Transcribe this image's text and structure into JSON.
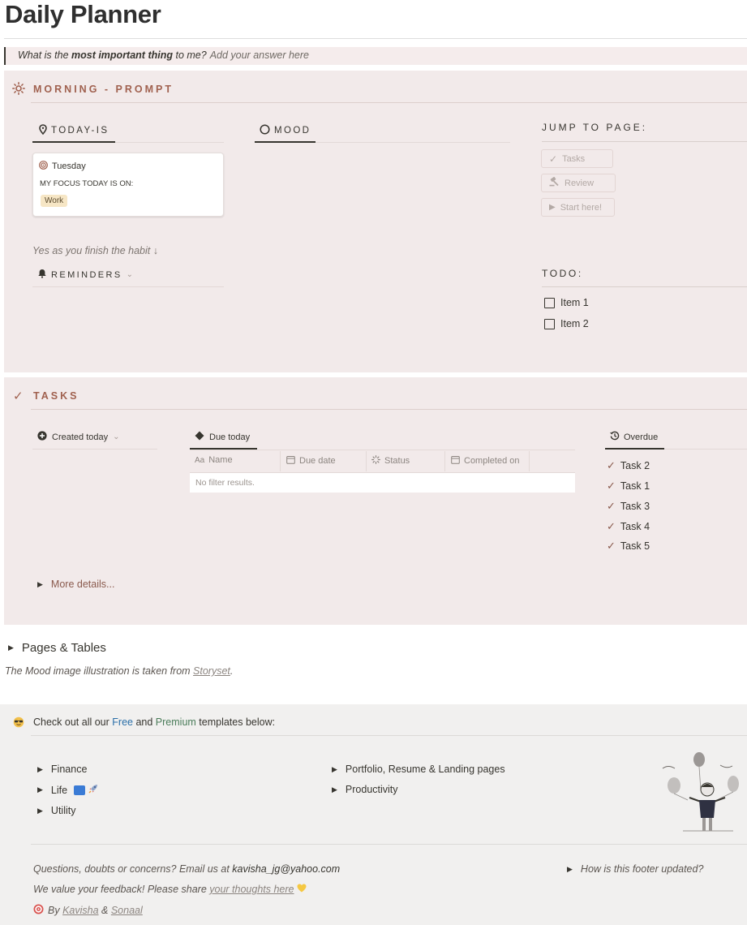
{
  "page": {
    "title": "Daily Planner"
  },
  "quote": {
    "prefix": "What is the ",
    "bold": "most important thing",
    "suffix": " to me?",
    "placeholder": "Add your answer here"
  },
  "morning": {
    "heading": "MORNING - PROMPT",
    "today_tab": "TODAY-IS",
    "mood_tab": "MOOD",
    "card": {
      "day": "Tuesday",
      "focus_label": "MY FOCUS TODAY IS ON:",
      "focus_tag": "Work"
    },
    "habit_hint": "Yes as you finish the habit ↓",
    "reminders_tab": "REMINDERS",
    "jump_heading": "JUMP TO PAGE:",
    "jump_buttons": [
      "Tasks",
      "Review",
      "Start here!"
    ],
    "todo_heading": "TODO:",
    "todo_items": [
      "Item 1",
      "Item 2"
    ]
  },
  "tasks": {
    "heading": "TASKS",
    "created_tab": "Created today",
    "due_tab": "Due today",
    "overdue_tab": "Overdue",
    "columns": [
      "Name",
      "Due date",
      "Status",
      "Completed on"
    ],
    "empty_text": "No filter results.",
    "overdue_items": [
      "Task 2",
      "Task 1",
      "Task 3",
      "Task 4",
      "Task 5"
    ],
    "more_details": "More details..."
  },
  "pages_tables": {
    "label": "Pages & Tables",
    "credit_prefix": "The Mood image illustration is taken from ",
    "credit_link": "Storyset",
    "credit_suffix": "."
  },
  "footer": {
    "intro_prefix": "Check out all our ",
    "free": "Free",
    "and": " and ",
    "premium": "Premium",
    "intro_suffix": " templates below:",
    "left_links": [
      "Finance",
      "Life",
      "Utility"
    ],
    "right_links": [
      "Portfolio, Resume & Landing pages",
      "Productivity"
    ],
    "questions_prefix": "Questions, doubts or concerns? Email us at ",
    "email": "kavisha_jg@yahoo.com",
    "feedback_prefix": "We value your feedback! Please share ",
    "feedback_link": "your thoughts here",
    "by": "By ",
    "author1": "Kavisha",
    "amp": " & ",
    "author2": "Sonaal",
    "footer_toggle": "How is this footer updated?"
  },
  "colors": {
    "panel": "#f2eaea",
    "accent": "#a0614f",
    "footer_panel": "#f1f0ef"
  }
}
